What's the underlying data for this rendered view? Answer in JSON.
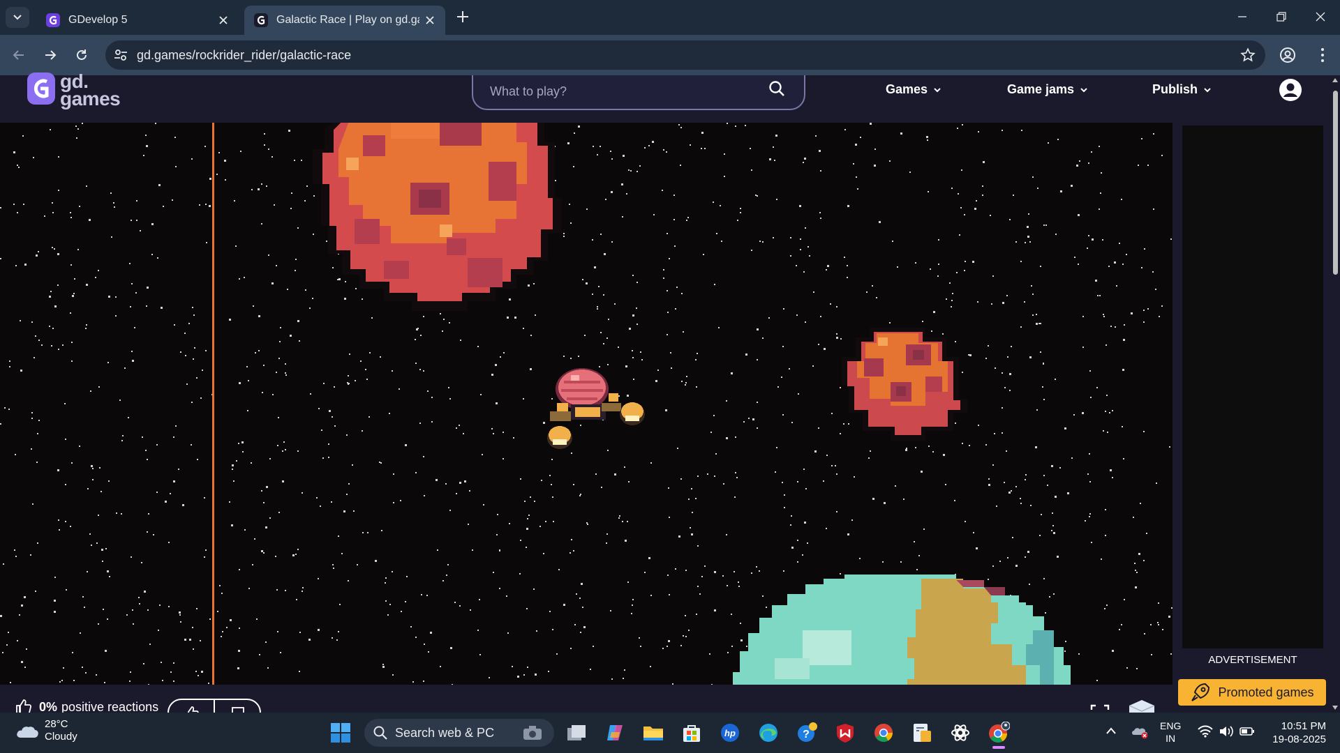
{
  "browser": {
    "tabs": [
      {
        "title": "GDevelop 5",
        "active": false
      },
      {
        "title": "Galactic Race | Play on gd.games",
        "active": true
      }
    ],
    "url": "gd.games/rockrider_rider/galactic-race"
  },
  "site": {
    "logo_text_top": "gd.",
    "logo_text_bottom": "games",
    "search_placeholder": "What to play?",
    "nav": [
      {
        "label": "Games"
      },
      {
        "label": "Game jams"
      },
      {
        "label": "Publish"
      }
    ],
    "advertisement_label": "ADVERTISEMENT",
    "promoted_label": "Promoted games"
  },
  "game": {
    "title": "Galactic Race",
    "reactions_pct": "0%",
    "reactions_label": "positive reactions",
    "colors": {
      "lane": "#e97531",
      "background": "#0a0808"
    }
  },
  "taskbar": {
    "weather_temp": "28°C",
    "weather_condition": "Cloudy",
    "search_label": "Search web & PC",
    "lang_top": "ENG",
    "lang_bottom": "IN",
    "time": "10:51 PM",
    "date": "19-08-2025"
  }
}
